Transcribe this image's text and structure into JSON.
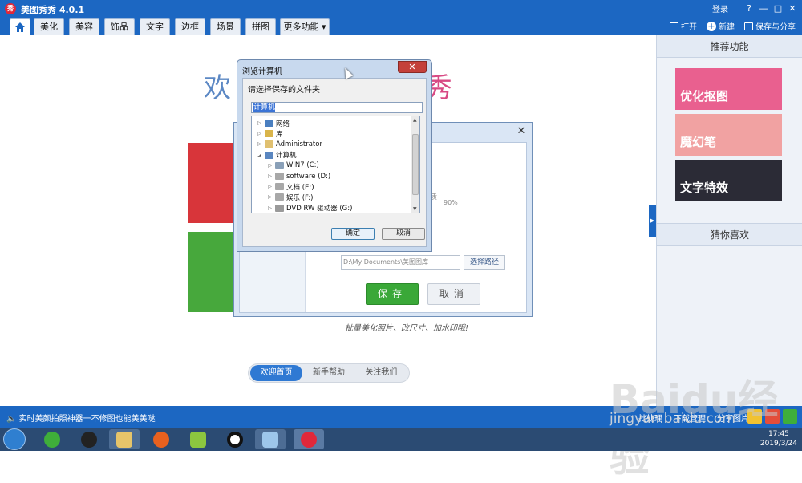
{
  "app": {
    "title": "美图秀秀 4.0.1",
    "logo_text": "秀",
    "login": "登录",
    "window_buttons": [
      "?",
      "—",
      "□",
      "✕"
    ]
  },
  "menu": {
    "tabs": [
      "美化",
      "美容",
      "饰品",
      "文字",
      "边框",
      "场景",
      "拼图",
      "更多功能 ▾"
    ],
    "open": "打开",
    "new": "新建",
    "save_share": "保存与分享"
  },
  "right_panel": {
    "header": "推荐功能",
    "cards": [
      "优化抠图",
      "魔幻笔",
      "文字特效"
    ],
    "card_colors": [
      "#e9608f",
      "#f1a2a2",
      "#2b2b36"
    ],
    "header2": "猜你喜欢"
  },
  "welcome": {
    "text_left": "欢",
    "text_right": "秀",
    "tagline": "批量美化照片、改尺寸、加水印哦!",
    "nav": [
      "欢迎首页",
      "新手帮助",
      "关注我们"
    ]
  },
  "save_dialog": {
    "option_text": "质",
    "quality_label": "90%",
    "path_value": "D:\\My Documents\\美图图库",
    "choose_path": "选择路径",
    "save": "保存",
    "cancel": "取消"
  },
  "browse_dialog": {
    "title": "浏览计算机",
    "prompt": "请选择保存的文件夹",
    "path": "计算机",
    "tree": [
      {
        "label": "网络",
        "level": 0,
        "expanded": false,
        "icon": "network-icon",
        "color": "#4a7fc0"
      },
      {
        "label": "库",
        "level": 0,
        "expanded": false,
        "icon": "library-icon",
        "color": "#d9b44a"
      },
      {
        "label": "Administrator",
        "level": 0,
        "expanded": false,
        "icon": "user-folder-icon",
        "color": "#e0c070"
      },
      {
        "label": "计算机",
        "level": 0,
        "expanded": true,
        "icon": "computer-icon",
        "color": "#5a86c0"
      },
      {
        "label": "WIN7 (C:)",
        "level": 1,
        "expanded": false,
        "icon": "windows-drive-icon",
        "color": "#8aa0b8"
      },
      {
        "label": "software (D:)",
        "level": 1,
        "expanded": false,
        "icon": "drive-icon",
        "color": "#a8a8a8"
      },
      {
        "label": "文档 (E:)",
        "level": 1,
        "expanded": false,
        "icon": "drive-icon",
        "color": "#a8a8a8"
      },
      {
        "label": "娱乐 (F:)",
        "level": 1,
        "expanded": false,
        "icon": "drive-icon",
        "color": "#a8a8a8"
      },
      {
        "label": "DVD RW 驱动器 (G:)",
        "level": 1,
        "expanded": false,
        "icon": "dvd-icon",
        "color": "#9a9a9a"
      }
    ],
    "ok": "确定",
    "cancel": "取消"
  },
  "status": {
    "tip": "实时美颜拍照神器一不修图也能美美哒",
    "batch": "批处理",
    "download": "下载管理",
    "share": "分享图片"
  },
  "taskbar": {
    "time": "17:45",
    "date": "2019/3/24"
  },
  "watermark": {
    "logo": "Baidu经验",
    "url": "jingyan.baidu.com"
  }
}
